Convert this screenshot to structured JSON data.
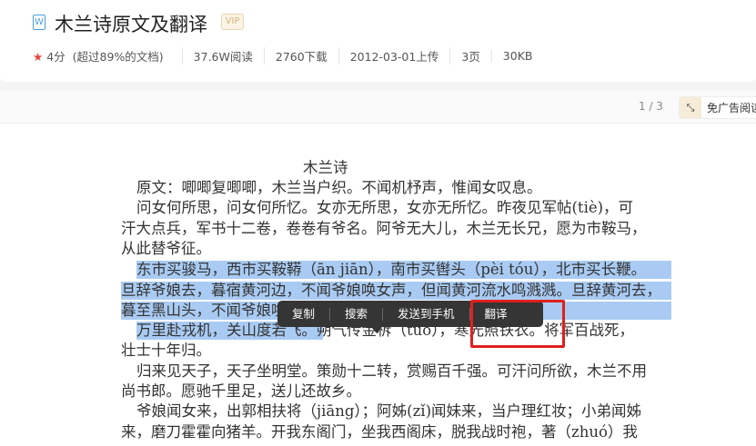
{
  "header": {
    "file_icon": "W",
    "title": "木兰诗原文及翻译",
    "badge": "VIP",
    "rating": "4分",
    "rating_note": "(超过89%的文档)",
    "reads": "37.6W阅读",
    "downloads": "2760下载",
    "upload": "2012-03-01上传",
    "pages": "3页",
    "size": "30KB"
  },
  "toolbar": {
    "pager": "1 / 3",
    "ad_free": "免广告阅读"
  },
  "doc": {
    "heading": "木兰诗",
    "lines": [
      "原文：唧唧复唧唧，木兰当户织。不闻机杼声，惟闻女叹息。",
      "问女何所思，问女何所忆。女亦无所思，女亦无所忆。昨夜见军帖(tiè)，可",
      "汗大点兵，军书十二卷，卷卷有爷名。阿爷无大儿，木兰无长兄，愿为市鞍马，",
      "从此替爷征。",
      "东市买骏马，西市买鞍鞯（ān jiān），南市买辔头（pèi tóu），北市买长鞭。",
      "旦辞爷娘去，暮宿黄河边，不闻爷娘唤女声，但闻黄河流水鸣溅溅。旦辞黄河去，",
      "暮至黑山头，不闻爷娘唤女声，但闻燕山胡骑鸣啾啾。",
      "万里赴戎机，关山度若飞。朔气传金柝（tuò），寒光照铁衣。将军百战死，",
      "壮士十年归。",
      "归来见天子，天子坐明堂。策勋十二转，赏赐百千强。可汗问所欲，木兰不用",
      "尚书郎。愿驰千里足，送儿还故乡。",
      "爷娘闻女来，出郭相扶将（jiāng）；阿姊(zǐ)闻妹来，当户理红妆；小弟闻姊",
      "来，磨刀霍霍向猪羊。开我东阁门，坐我西阁床，脱我战时袍，著（zhuó）我"
    ]
  },
  "popup": {
    "copy": "复制",
    "search": "搜索",
    "send": "发送到手机",
    "translate": "翻译"
  }
}
